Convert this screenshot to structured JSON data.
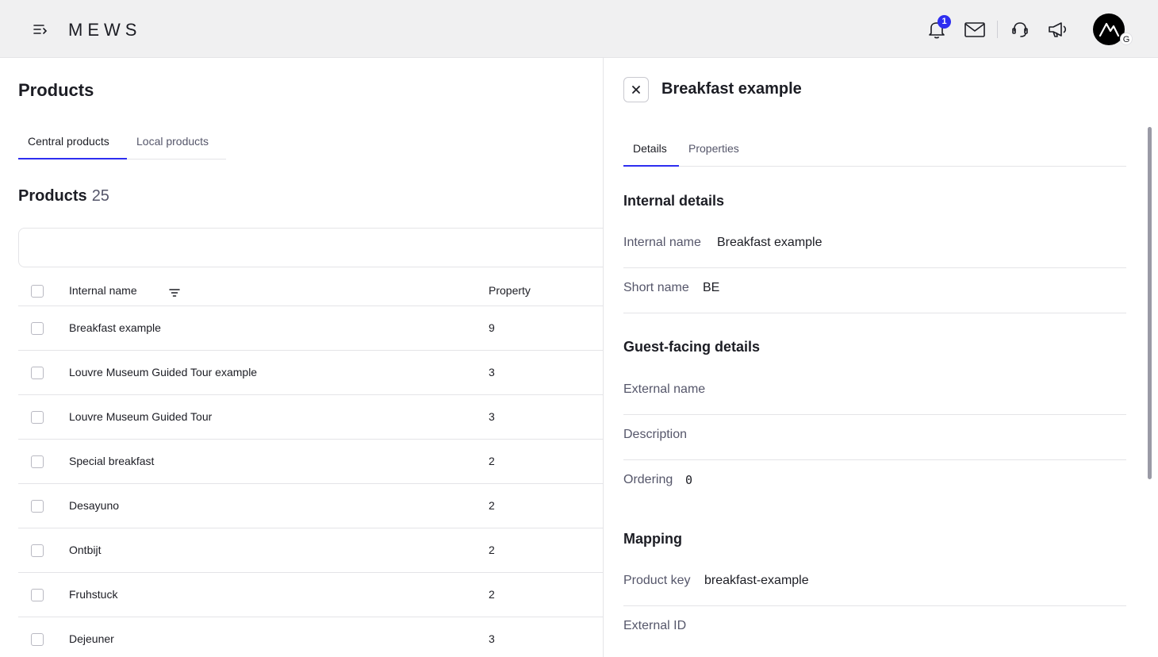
{
  "header": {
    "brand": "MEWS",
    "notification_count": "1",
    "avatar_tag": "G"
  },
  "page": {
    "title": "Products",
    "tabs": [
      {
        "label": "Central products",
        "active": true
      },
      {
        "label": "Local products",
        "active": false
      }
    ],
    "section_title": "Products",
    "product_count": "25"
  },
  "table": {
    "columns": [
      "Internal name",
      "Property"
    ],
    "rows": [
      {
        "name": "Breakfast example",
        "property": "9"
      },
      {
        "name": "Louvre Museum Guided Tour example",
        "property": "3"
      },
      {
        "name": "Louvre Museum Guided Tour",
        "property": "3"
      },
      {
        "name": "Special breakfast",
        "property": "2"
      },
      {
        "name": "Desayuno",
        "property": "2"
      },
      {
        "name": "Ontbijt",
        "property": "2"
      },
      {
        "name": "Fruhstuck",
        "property": "2"
      },
      {
        "name": "Dejeuner",
        "property": "3"
      }
    ]
  },
  "detail": {
    "title": "Breakfast example",
    "tabs": [
      {
        "label": "Details",
        "active": true
      },
      {
        "label": "Properties",
        "active": false
      }
    ],
    "internal_heading": "Internal details",
    "internal_name_label": "Internal name",
    "internal_name_value": "Breakfast example",
    "short_name_label": "Short name",
    "short_name_value": "BE",
    "guest_heading": "Guest-facing details",
    "external_name_label": "External name",
    "description_label": "Description",
    "ordering_label": "Ordering",
    "ordering_value": "0",
    "mapping_heading": "Mapping",
    "product_key_label": "Product key",
    "product_key_value": "breakfast-example",
    "external_id_label": "External ID"
  },
  "colors": {
    "accent": "#2e2ef0",
    "topbar": "#f0f0f1",
    "text": "#1c1d24",
    "muted": "#55566a"
  },
  "icons": [
    "menu-icon",
    "bell-icon",
    "mail-icon",
    "headset-icon",
    "megaphone-icon",
    "mews-avatar-icon",
    "filter-icon",
    "close-icon"
  ]
}
